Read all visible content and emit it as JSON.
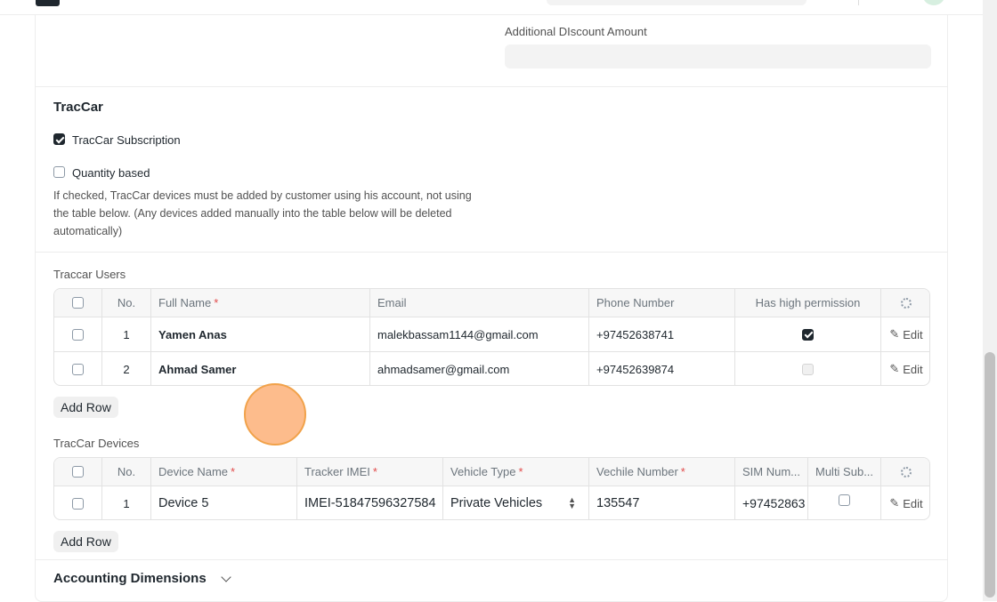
{
  "discount": {
    "label": "Additional DIscount Amount",
    "value": ""
  },
  "traccar": {
    "title": "TracCar",
    "subscription_label": "TracCar Subscription",
    "subscription_checked": true,
    "quantity_label": "Quantity based",
    "quantity_checked": false,
    "quantity_description": "If checked, TracCar devices must be added by customer using his account, not using the table below. (Any devices added manually into the table below will be deleted automatically)"
  },
  "users_table": {
    "label": "Traccar Users",
    "columns": [
      "No.",
      "Full Name",
      "Email",
      "Phone Number",
      "Has high permission"
    ],
    "rows": [
      {
        "no": "1",
        "full_name": "Yamen Anas",
        "email": "malekbassam1144@gmail.com",
        "phone": "+97452638741",
        "high_permission": true,
        "edit": "Edit"
      },
      {
        "no": "2",
        "full_name": "Ahmad Samer",
        "email": "ahmadsamer@gmail.com",
        "phone": "+97452639874",
        "high_permission": false,
        "edit": "Edit"
      }
    ],
    "add_row": "Add Row"
  },
  "devices_table": {
    "label": "TracCar Devices",
    "columns": [
      "No.",
      "Device Name",
      "Tracker IMEI",
      "Vehicle Type",
      "Vechile Number",
      "SIM Num...",
      "Multi Sub..."
    ],
    "rows": [
      {
        "no": "1",
        "device_name": "Device 5",
        "tracker_imei": "IMEI-51847596327584",
        "vehicle_type": "Private Vehicles",
        "vehicle_number": "135547",
        "sim_number": "+97452863",
        "multi_sub": false,
        "edit": "Edit"
      }
    ],
    "add_row": "Add Row"
  },
  "accounting": {
    "title": "Accounting Dimensions"
  },
  "icons": [
    "settings-gear-icon",
    "edit-pencil-icon",
    "chevron-down-icon",
    "select-arrows-icon"
  ],
  "colors": {
    "required": "#e24c4c",
    "check_on": "#1f272e",
    "cursor_highlight": "#fdb078"
  }
}
